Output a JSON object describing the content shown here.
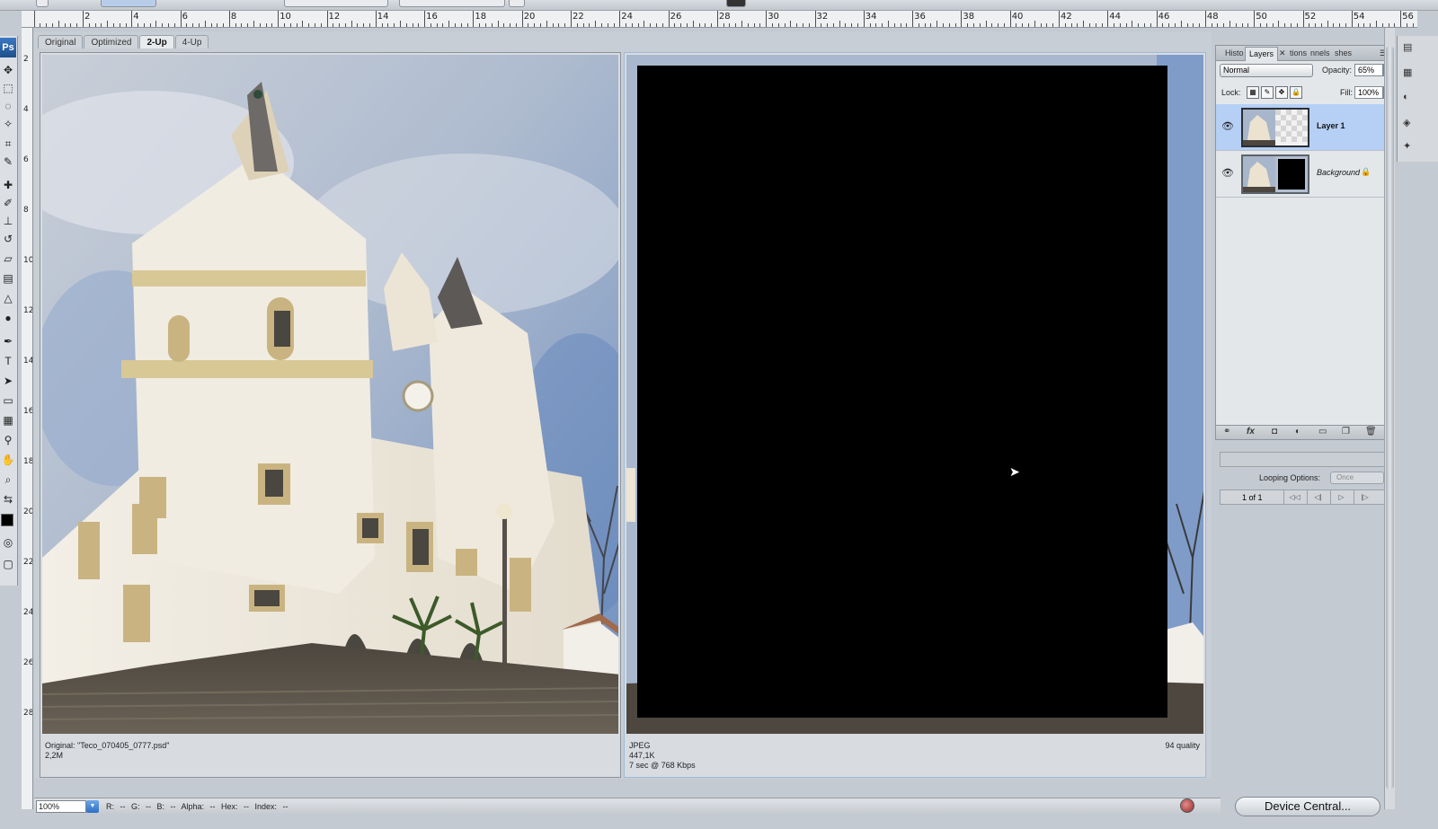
{
  "view_tabs": [
    "Original",
    "Optimized",
    "2-Up",
    "4-Up"
  ],
  "active_tab": "2-Up",
  "ruler_numbers": [
    "2",
    "4",
    "6",
    "8",
    "10",
    "12",
    "14",
    "16",
    "18",
    "20",
    "22",
    "24",
    "26",
    "28",
    "30",
    "32",
    "34",
    "36",
    "38",
    "40",
    "42",
    "44",
    "46",
    "48",
    "50",
    "52",
    "54",
    "56"
  ],
  "vruler_numbers": [
    "2",
    "4",
    "6",
    "8",
    "10",
    "12",
    "14",
    "16",
    "18",
    "20",
    "22",
    "24",
    "26",
    "28"
  ],
  "original_pane": {
    "title": "Original: \"Teco_070405_0777.psd\"",
    "size": "2,2M"
  },
  "optimized_pane": {
    "format": "JPEG",
    "size": "447,1K",
    "download": "7 sec @ 768 Kbps",
    "quality": "94 quality"
  },
  "statusbar": {
    "zoom": "100%",
    "readout": "R:   --   G:   --   B:   --   Alpha:   --   Hex:   --   Index:   --"
  },
  "device_central_label": "Device Central...",
  "layers_panel": {
    "tabs": [
      "Histo",
      "Layers",
      "tions",
      "nnels",
      "shes"
    ],
    "active_tab": "Layers",
    "blend_mode": "Normal",
    "opacity_label": "Opacity:",
    "opacity": "65%",
    "lock_label": "Lock:",
    "fill_label": "Fill:",
    "fill": "100%",
    "layers": [
      {
        "name": "Layer 1",
        "selected": true
      },
      {
        "name": "Background",
        "selected": false
      }
    ]
  },
  "animation": {
    "looping_label": "Looping Options:",
    "looping_value": "Once",
    "frame_count": "1 of 1"
  },
  "icons": [
    "eye-icon",
    "lock-icon",
    "link-icon",
    "fx-icon",
    "mask-icon",
    "adjustment-icon",
    "folder-icon",
    "new-layer-icon",
    "trash-icon",
    "globe-icon"
  ]
}
